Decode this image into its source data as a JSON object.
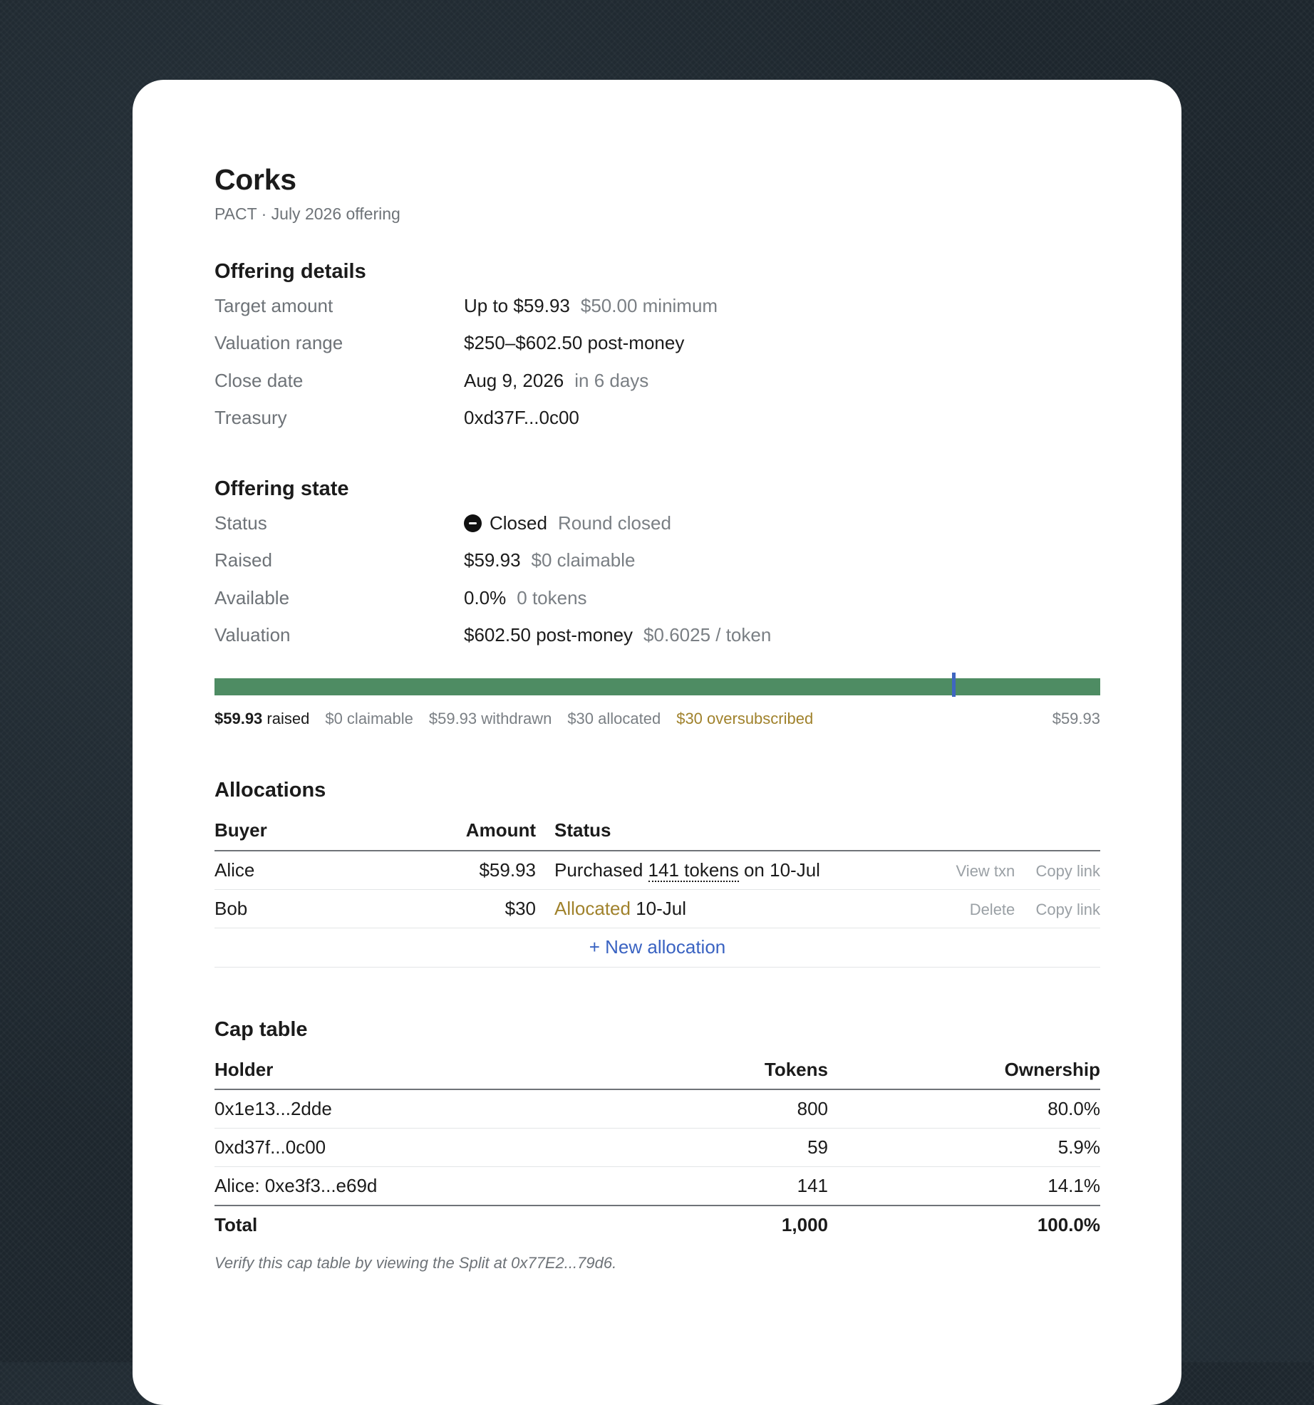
{
  "header": {
    "title": "Corks",
    "subtitle": "PACT · July 2026 offering"
  },
  "offering_details": {
    "heading": "Offering details",
    "rows": [
      {
        "label": "Target amount",
        "value": "Up to $59.93",
        "note": "$50.00 minimum"
      },
      {
        "label": "Valuation range",
        "value": "$250–$602.50 post-money",
        "note": ""
      },
      {
        "label": "Close date",
        "value": "Aug 9, 2026",
        "note": "in 6 days"
      },
      {
        "label": "Treasury",
        "value": "0xd37F...0c00",
        "note": ""
      }
    ]
  },
  "offering_state": {
    "heading": "Offering state",
    "status": {
      "label": "Status",
      "icon": "minus-circle-icon",
      "value": "Closed",
      "note": "Round closed"
    },
    "raised": {
      "label": "Raised",
      "value": "$59.93",
      "note": "$0 claimable"
    },
    "available": {
      "label": "Available",
      "value": "0.0%",
      "note": "0 tokens"
    },
    "valuation": {
      "label": "Valuation",
      "value": "$602.50 post-money",
      "note": "$0.6025 / token"
    }
  },
  "progress": {
    "fill_fraction": 1.0,
    "marker_fraction": 0.834,
    "fill_color": "#4e8c63",
    "marker_color": "#3f66c0",
    "legend": {
      "raised_amount": "$59.93",
      "raised_suffix": "raised",
      "claimable": "$0 claimable",
      "withdrawn": "$59.93 withdrawn",
      "allocated": "$30 allocated",
      "oversubscribed": "$30 oversubscribed",
      "max": "$59.93"
    }
  },
  "allocations": {
    "heading": "Allocations",
    "columns": {
      "buyer": "Buyer",
      "amount": "Amount",
      "status": "Status"
    },
    "rows": [
      {
        "buyer": "Alice",
        "amount": "$59.93",
        "status_prefix": "Purchased ",
        "status_tokens": "141 tokens",
        "status_suffix": " on 10-Jul",
        "action_1": "View txn",
        "action_2": "Copy link"
      },
      {
        "buyer": "Bob",
        "amount": "$30",
        "status_highlight": "Allocated",
        "status_suffix": " 10-Jul",
        "action_1": "Delete",
        "action_2": "Copy link"
      }
    ],
    "new_label": "+ New allocation"
  },
  "cap_table": {
    "heading": "Cap table",
    "columns": {
      "holder": "Holder",
      "tokens": "Tokens",
      "ownership": "Ownership"
    },
    "rows": [
      {
        "holder": "0x1e13...2dde",
        "tokens": "800",
        "ownership": "80.0%"
      },
      {
        "holder": "0xd37f...0c00",
        "tokens": "59",
        "ownership": "5.9%"
      },
      {
        "holder": "Alice: 0xe3f3...e69d",
        "tokens": "141",
        "ownership": "14.1%"
      }
    ],
    "total": {
      "label": "Total",
      "tokens": "1,000",
      "ownership": "100.0%"
    },
    "note": "Verify this cap table by viewing the Split at 0x77E2...79d6."
  },
  "colors": {
    "accent_blue": "#3a63c2",
    "gold": "#a0822c",
    "muted": "#7a7f84"
  }
}
